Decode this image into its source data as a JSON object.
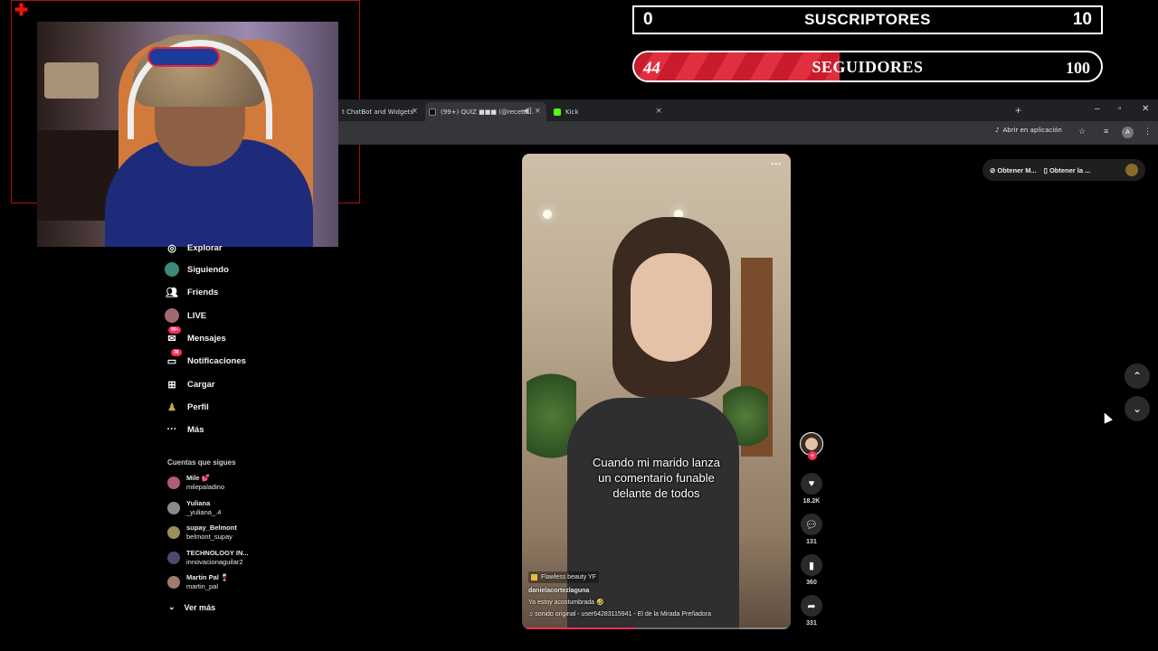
{
  "overlay": {
    "suscriptores": {
      "current": "0",
      "label": "SUSCRIPTORES",
      "goal": "10"
    },
    "seguidores": {
      "current": "44",
      "label": "SEGUIDORES",
      "goal": "100",
      "progress": 0.44
    }
  },
  "browser": {
    "tabs": [
      {
        "title": "t ChatBot and Widgets",
        "close": "×"
      },
      {
        "title": "(99+) QUIZ ■■■ (@receta...",
        "close": "×"
      },
      {
        "title": "Kick",
        "close": "×"
      }
    ],
    "new_tab": "+",
    "window_controls": {
      "minimize": "–",
      "restore": "▫",
      "close": "✕"
    },
    "open_in_app": "Abrir en aplicación"
  },
  "sidebar": {
    "items": [
      {
        "label": "Explorar",
        "icon": "compass-icon"
      },
      {
        "label": "Siguiendo",
        "icon": "following-avatar-icon"
      },
      {
        "label": "Friends",
        "icon": "friends-icon"
      },
      {
        "label": "LIVE",
        "icon": "live-icon"
      },
      {
        "label": "Mensajes",
        "icon": "messages-icon",
        "badge": "99+"
      },
      {
        "label": "Notificaciones",
        "icon": "bell-icon",
        "badge": "38"
      },
      {
        "label": "Cargar",
        "icon": "upload-icon"
      },
      {
        "label": "Perfil",
        "icon": "profile-icon"
      },
      {
        "label": "Más",
        "icon": "more-icon"
      }
    ],
    "following_header": "Cuentas que sigues",
    "following": [
      {
        "name": "Mile 💕",
        "handle": "milepaladino"
      },
      {
        "name": "Yuliana",
        "handle": "_yuliana_.4"
      },
      {
        "name": "supay_Belmont",
        "handle": "belmont_supay"
      },
      {
        "name": "TECHNOLOGY IN...",
        "handle": "innovacionaguilar2"
      },
      {
        "name": "Martin Pal 🍷",
        "handle": "martin_pal"
      }
    ],
    "see_more": "Ver más"
  },
  "video": {
    "caption_lines": [
      "Cuando mi marido lanza",
      "un comentario funable",
      "delante de todos"
    ],
    "effect": "Flawless beauty YF",
    "author": "danielacortezlaguna",
    "description": "Ya estoy acostumbrada 🤣",
    "sound": "♫ sonido original - user64283115941 - El de la Mirada Preñadora",
    "more": "···",
    "progress": 0.42
  },
  "actions": {
    "likes": "18.2K",
    "comments": "131",
    "saves": "360",
    "shares": "331"
  },
  "right_panel": {
    "get_coins": "Obtener M...",
    "get_app": "Obtener la ..."
  }
}
